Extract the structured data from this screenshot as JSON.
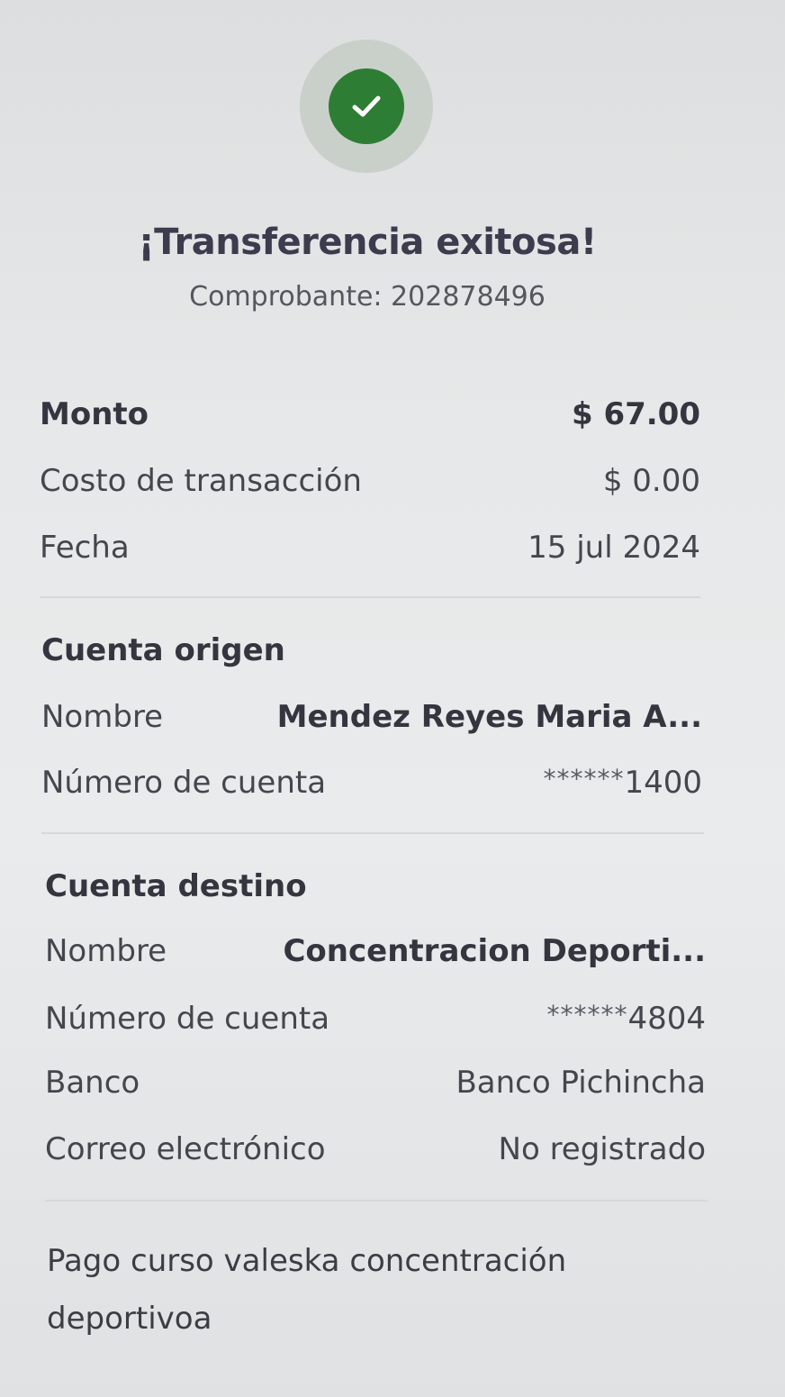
{
  "header": {
    "icon": "check-icon",
    "title": "¡Transferencia exitosa!",
    "receipt_label": "Comprobante: 202878496"
  },
  "summary": {
    "amount_label": "Monto",
    "amount_value": "$ 67.00",
    "fee_label": "Costo de transacción",
    "fee_value": "$ 0.00",
    "date_label": "Fecha",
    "date_value": "15 jul 2024"
  },
  "origin": {
    "section_title": "Cuenta origen",
    "name_label": "Nombre",
    "name_value": "Mendez  Reyes Maria A...",
    "account_label": "Número de cuenta",
    "account_mask": "******",
    "account_last": "1400"
  },
  "destination": {
    "section_title": "Cuenta destino",
    "name_label": "Nombre",
    "name_value": "Concentracion Deporti...",
    "account_label": "Número de cuenta",
    "account_mask": "******",
    "account_last": "4804",
    "bank_label": "Banco",
    "bank_value": "Banco Pichincha",
    "email_label": "Correo electrónico",
    "email_value": "No registrado"
  },
  "memo": {
    "text": "Pago curso valeska concentración deportivoa"
  },
  "colors": {
    "success_green": "#2e7d34",
    "success_halo": "#c9d0c9",
    "text_dark": "#34353f"
  }
}
